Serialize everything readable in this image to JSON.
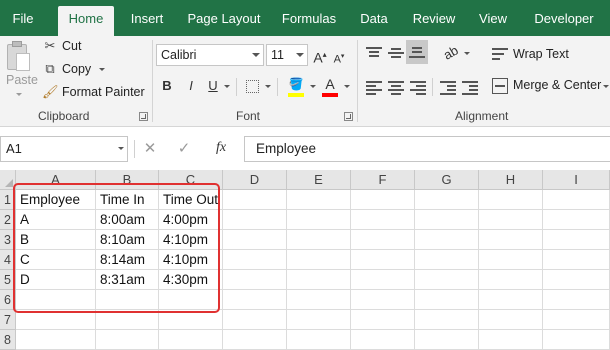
{
  "ribbon_tabs": [
    "File",
    "Home",
    "Insert",
    "Page Layout",
    "Formulas",
    "Data",
    "Review",
    "View",
    "Developer"
  ],
  "active_tab": "Home",
  "clipboard": {
    "paste_label": "Paste",
    "cut_label": "Cut",
    "copy_label": "Copy",
    "format_painter_label": "Format Painter",
    "group_label": "Clipboard"
  },
  "font": {
    "name": "Calibri",
    "size": "11",
    "group_label": "Font",
    "bold": "B",
    "italic": "I",
    "underline": "U",
    "highlight_color": "#ffff00",
    "font_color": "#ff0000"
  },
  "alignment": {
    "wrap_text_label": "Wrap Text",
    "merge_center_label": "Merge & Center",
    "group_label": "Alignment"
  },
  "formula_bar": {
    "name_box": "A1",
    "fx": "fx",
    "value": "Employee"
  },
  "sheet": {
    "columns": [
      "A",
      "B",
      "C",
      "D",
      "E",
      "F",
      "G",
      "H",
      "I"
    ],
    "rows": [
      "1",
      "2",
      "3",
      "4",
      "5",
      "6",
      "7",
      "8"
    ],
    "cells": [
      [
        "Employee",
        "Time In",
        "Time Out"
      ],
      [
        "A",
        "8:00am",
        "4:00pm"
      ],
      [
        "B",
        "8:10am",
        "4:10pm"
      ],
      [
        "C",
        "8:14am",
        "4:10pm"
      ],
      [
        "D",
        "8:31am",
        "4:30pm"
      ]
    ]
  },
  "colors": {
    "accent": "#217346",
    "highlight_box": "#e03131"
  }
}
